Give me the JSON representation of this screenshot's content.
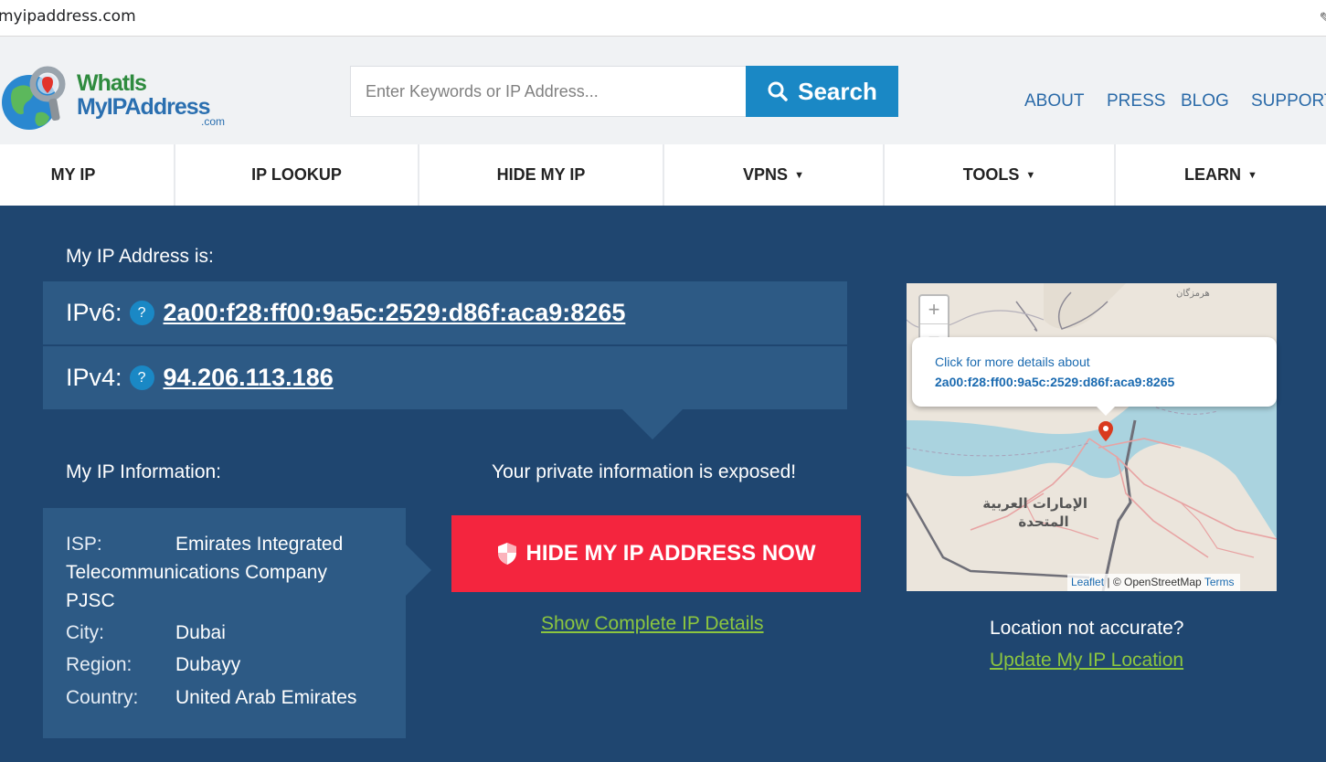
{
  "browser": {
    "url": "myipaddress.com"
  },
  "header": {
    "logo": {
      "line1": "WhatIs",
      "line2": "MyIPAddress",
      "line3": ".com"
    },
    "search": {
      "placeholder": "Enter Keywords or IP Address...",
      "button_label": "Search"
    },
    "links": [
      "ABOUT",
      "PRESS",
      "BLOG",
      "SUPPORT"
    ]
  },
  "nav": [
    {
      "label": "MY IP",
      "dropdown": false
    },
    {
      "label": "IP LOOKUP",
      "dropdown": false
    },
    {
      "label": "HIDE MY IP",
      "dropdown": false
    },
    {
      "label": "VPNS",
      "dropdown": true
    },
    {
      "label": "TOOLS",
      "dropdown": true
    },
    {
      "label": "LEARN",
      "dropdown": true
    }
  ],
  "main": {
    "ip_heading": "My IP Address is:",
    "ipv6": {
      "label": "IPv6:",
      "help": "?",
      "value": "2a00:f28:ff00:9a5c:2529:d86f:aca9:8265"
    },
    "ipv4": {
      "label": "IPv4:",
      "help": "?",
      "value": "94.206.113.186"
    },
    "info_heading": "My IP Information:",
    "info": {
      "isp_label": "ISP:",
      "isp_line1": "Emirates Integrated",
      "isp_line2": "Telecommunications Company",
      "isp_line3": "PJSC",
      "city_label": "City:",
      "city": "Dubai",
      "region_label": "Region:",
      "region": "Dubayy",
      "country_label": "Country:",
      "country": "United Arab Emirates"
    },
    "exposed_text": "Your private information is exposed!",
    "hide_button": "HIDE MY IP ADDRESS NOW",
    "show_details_link": "Show Complete IP Details",
    "location_question": "Location not accurate?",
    "update_link": "Update My IP Location"
  },
  "map": {
    "zoom_in": "+",
    "zoom_out": "−",
    "popup_line1": "Click for more details about",
    "popup_line2": "2a00:f28:ff00:9a5c:2529:d86f:aca9:8265",
    "label_country_1": "الإمارات العربية",
    "label_country_2": "المتحدة",
    "label_top": "هرمزگان",
    "attrib_leaflet": "Leaflet",
    "attrib_sep": " | © OpenStreetMap ",
    "attrib_terms": "Terms"
  },
  "colors": {
    "accent": "#1a88c5",
    "danger": "#f4253e",
    "link_green": "#8cc63f",
    "bg_main": "#1f4670",
    "panel": "#2d5a85"
  }
}
